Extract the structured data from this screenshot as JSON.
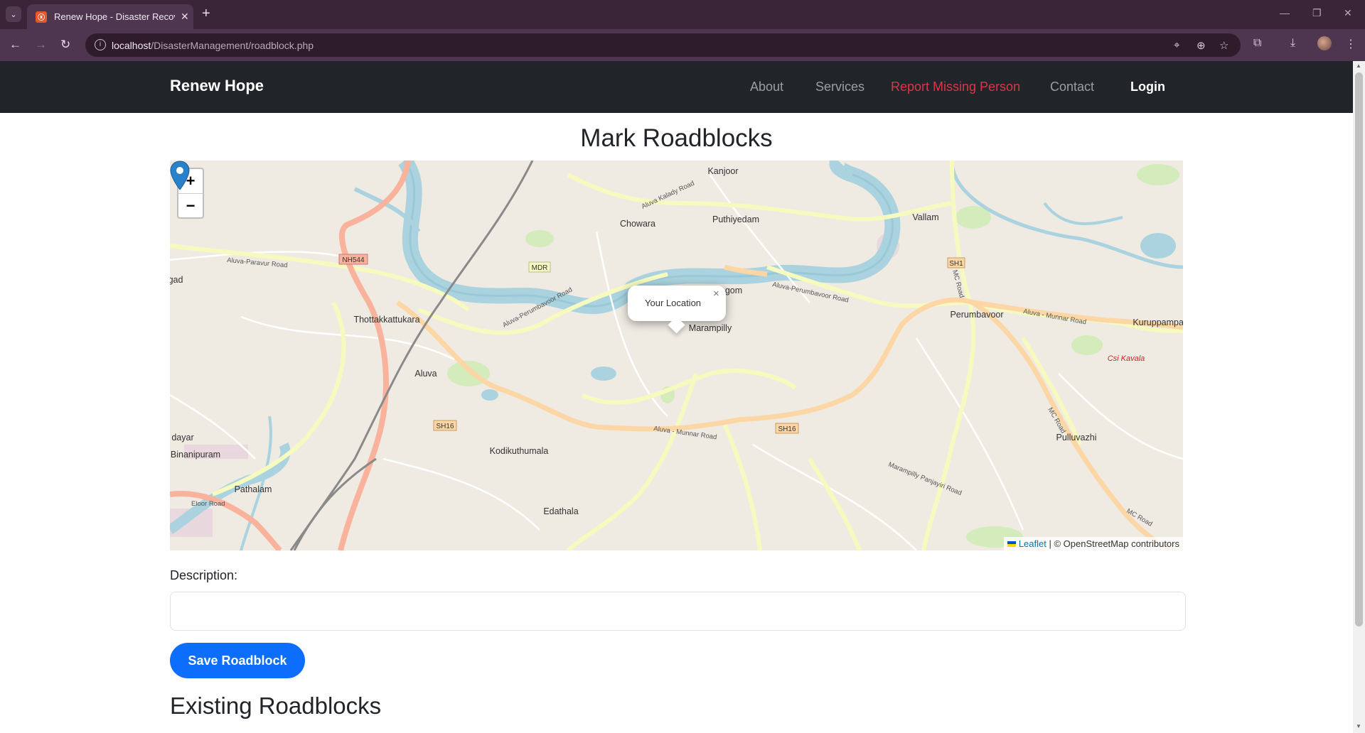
{
  "browser": {
    "tab_title": "Renew Hope - Disaster Recover",
    "favicon": "xampp-icon",
    "url_host": "localhost",
    "url_path": "/DisasterManagement/roadblock.php"
  },
  "nav": {
    "brand": "Renew Hope",
    "links": [
      "About",
      "Services",
      "Report Missing Person",
      "Contact",
      "Login"
    ],
    "highlight_color": "#dc3545"
  },
  "page": {
    "title": "Mark Roadblocks",
    "description_label": "Description:",
    "description_value": "",
    "save_button": "Save Roadblock",
    "existing_heading": "Existing Roadblocks"
  },
  "map": {
    "popup_text": "Your Location",
    "zoom_in": "+",
    "zoom_out": "−",
    "attribution_leaflet": "Leaflet",
    "attribution_rest": "| © OpenStreetMap contributors",
    "places": [
      "Kanjoor",
      "Chowara",
      "Puthiyedam",
      "Vallam",
      "Thottakkattukara",
      "Marampilly",
      "Perumbavoor",
      "Kuruppampadi",
      "Aluva",
      "Csi Kavala",
      "Kodikuthumala",
      "Binanipuram",
      "Pathalam",
      "Edathala",
      "Pulluvazhi",
      "dayar",
      "gad",
      "gom"
    ],
    "road_labels": [
      "NH544",
      "MDR",
      "SH1",
      "SH16",
      "SH16",
      "Aluva-Paravur Road",
      "Aluva Kalady Road",
      "Aluva-Perumbavoor Road",
      "Aluva - Munnar Road",
      "MC Road",
      "Eloor Road",
      "Marampilly Panjayiri Road"
    ],
    "accent_colors": {
      "water": "#aad3df",
      "primary_road": "#fcd6a4",
      "trunk": "#f9b29c",
      "marker": "#2a81cb"
    }
  }
}
